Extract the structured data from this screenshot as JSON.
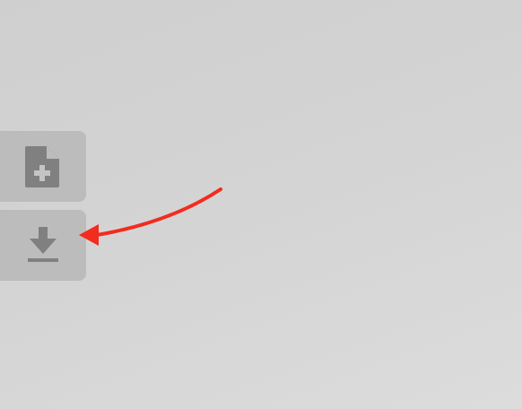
{
  "toolbar": {
    "buttons": [
      {
        "id": "new-document",
        "icon": "file-plus-icon"
      },
      {
        "id": "download",
        "icon": "download-icon"
      }
    ],
    "icon_color": "#808080",
    "button_color": "#bcbcbc"
  },
  "annotation": {
    "type": "arrow",
    "color": "#f22c1e",
    "points_to": "download"
  }
}
